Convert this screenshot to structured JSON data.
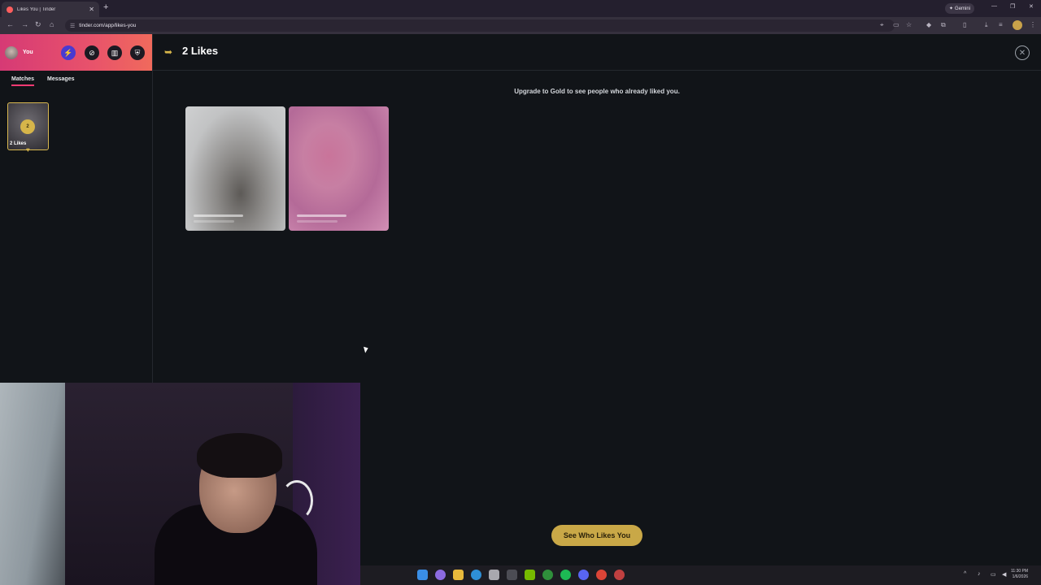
{
  "browser": {
    "tab_title": "Likes You | Tinder",
    "new_tab": "+",
    "url": "tinder.com/app/likes-you",
    "gemini_label": "Gemini",
    "icons": [
      "back-icon",
      "forward-icon",
      "reload-icon",
      "home-icon",
      "site-info-icon",
      "location-icon",
      "cast-icon",
      "bookmark-star-icon",
      "extension-icon",
      "puzzle-icon",
      "split-view-icon",
      "download-icon",
      "sliders-icon",
      "menu-icon"
    ]
  },
  "sidebar": {
    "user_label": "You",
    "header_buttons": [
      "boost-icon",
      "explore-icon",
      "passport-icon",
      "safety-shield-icon"
    ],
    "tabs": [
      {
        "label": "Matches",
        "active": true
      },
      {
        "label": "Messages",
        "active": false
      }
    ],
    "likes_card": {
      "count": "2",
      "label": "2 Likes"
    }
  },
  "main": {
    "title": "2 Likes",
    "upgrade_text": "Upgrade to Gold to see people who already liked you.",
    "cta_label": "See Who Likes You"
  },
  "taskbar": {
    "apps": [
      "windows-start-icon",
      "copilot-icon",
      "file-explorer-icon",
      "edge-icon",
      "store-icon",
      "terminal-icon",
      "nvidia-icon",
      "xbox-icon",
      "spotify-icon",
      "discord-icon",
      "chrome-icon",
      "app-icon"
    ],
    "time": "11:30 PM",
    "date": "1/6/2026"
  },
  "colors": {
    "accent_pink": "#fd3a73",
    "gold": "#c9a847",
    "background": "#111418"
  }
}
